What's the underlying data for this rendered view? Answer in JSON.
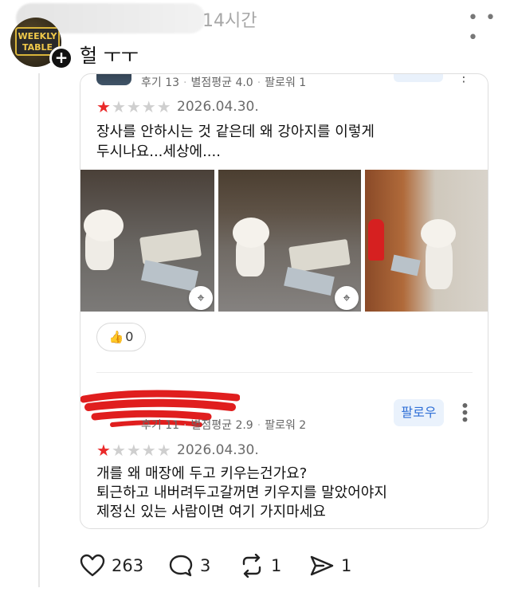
{
  "post": {
    "time": "14시간",
    "more_icon": "more-horizontal-icon",
    "text": "헐 ㅜㅜ",
    "avatar_sign": "WEEKLY TABLE",
    "follow_badge": "+"
  },
  "review_card": {
    "review1": {
      "meta": {
        "reviews": "후기 13",
        "avg_rating": "별점평균 4.0",
        "followers": "팔로워 1"
      },
      "rating": 1,
      "date": "2026.04.30.",
      "body_line1": "장사를 안하시는 것 같은데 왜 강아지를 이렇게",
      "body_line2": "두시나요...세상에....",
      "photos": [
        "dog-photo-1",
        "dog-photo-2",
        "dog-photo-3"
      ],
      "like_count": "0"
    },
    "review2": {
      "meta": {
        "reviews": "후기 11",
        "avg_rating": "별점평균 2.9",
        "followers": "팔로워 2"
      },
      "follow_label": "팔로우",
      "rating": 1,
      "date": "2026.04.30.",
      "body_line1": "개를 왜 매장에 두고 키우는건가요?",
      "body_line2": "퇴근하고 내버려두고갈꺼면 키우지를 말았어야지",
      "body_line3": "제정신 있는 사람이면 여기 가지마세요"
    }
  },
  "actions": {
    "likes": "263",
    "comments": "3",
    "reposts": "1",
    "shares": "1"
  },
  "colors": {
    "star_on": "#ea2a2a",
    "star_off": "#cfcfcf",
    "follow_text": "#2f6fd6",
    "follow_bg": "#eaf2fc"
  }
}
